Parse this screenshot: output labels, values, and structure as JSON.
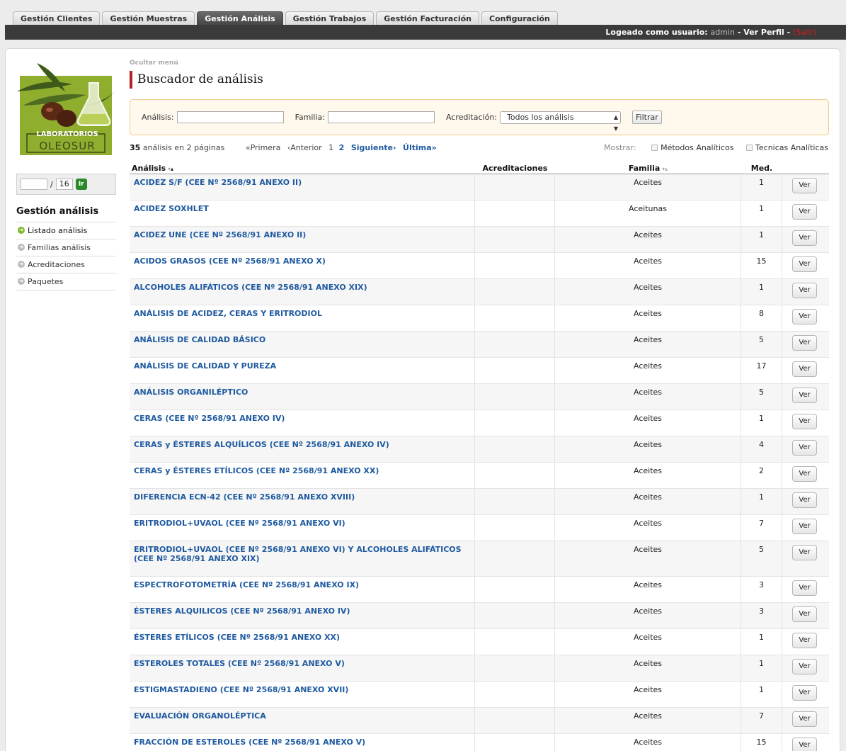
{
  "tabs": [
    {
      "label": "Gestión Clientes",
      "active": false
    },
    {
      "label": "Gestión Muestras",
      "active": false
    },
    {
      "label": "Gestión Análisis",
      "active": true
    },
    {
      "label": "Gestión Trabajos",
      "active": false
    },
    {
      "label": "Gestión Facturación",
      "active": false
    },
    {
      "label": "Configuración",
      "active": false
    }
  ],
  "userbar": {
    "prefix": "Logeado como usuario:",
    "user": "admin",
    "sep1": "-",
    "profile": "Ver Perfil",
    "sep2": "-",
    "logout": "(Salir)"
  },
  "logo": {
    "line1": "LABORATORIOS",
    "line2": "OLEOSUR",
    "colors": {
      "green": "#8fae2e",
      "dark": "#3d4a1c"
    }
  },
  "goto": {
    "value": "",
    "total": "16",
    "button": "Ir"
  },
  "sidebar": {
    "title": "Gestión análisis",
    "items": [
      {
        "label": "Listado análisis",
        "active": true
      },
      {
        "label": "Familias análisis",
        "active": false
      },
      {
        "label": "Acreditaciones",
        "active": false
      },
      {
        "label": "Paquetes",
        "active": false
      }
    ]
  },
  "content": {
    "hide_menu": "Ocultar menú",
    "title": "Buscador de análisis"
  },
  "filter": {
    "analisis_label": "Análisis:",
    "analisis_value": "",
    "familia_label": "Familia:",
    "familia_value": "",
    "acreditacion_label": "Acreditación:",
    "acreditacion_value": "Todos los análisis",
    "button": "Filtrar"
  },
  "pager": {
    "count": "35",
    "count_text": "análisis en 2 páginas",
    "first": "«Primera",
    "prev": "‹Anterior",
    "page1": "1",
    "page2": "2",
    "next": "Siguiente›",
    "last": "Última»"
  },
  "show": {
    "label": "Mostrar:",
    "opt1": "Métodos Analíticos",
    "opt2": "Tecnicas Analíticas"
  },
  "table": {
    "headers": {
      "analisis": "Análisis",
      "acreditaciones": "Acreditaciones",
      "familia": "Familia",
      "med": "Med."
    },
    "ver_label": "Ver",
    "rows": [
      {
        "name": "ACIDEZ S/F (CEE Nº 2568/91 ANEXO II)",
        "acred": "",
        "familia": "Aceites",
        "med": "1"
      },
      {
        "name": "ACIDEZ SOXHLET",
        "acred": "",
        "familia": "Aceitunas",
        "med": "1"
      },
      {
        "name": "ACIDEZ UNE (CEE Nº 2568/91 ANEXO II)",
        "acred": "",
        "familia": "Aceites",
        "med": "1"
      },
      {
        "name": "ACIDOS GRASOS (CEE Nº 2568/91 ANEXO X)",
        "acred": "",
        "familia": "Aceites",
        "med": "15"
      },
      {
        "name": "ALCOHOLES ALIFÁTICOS (CEE Nº 2568/91 ANEXO XIX)",
        "acred": "",
        "familia": "Aceites",
        "med": "1"
      },
      {
        "name": "ANÁLISIS DE ACIDEZ, CERAS Y ERITRODIOL",
        "acred": "",
        "familia": "Aceites",
        "med": "8"
      },
      {
        "name": "ANÁLISIS DE CALIDAD BÁSICO",
        "acred": "",
        "familia": "Aceites",
        "med": "5"
      },
      {
        "name": "ANÁLISIS DE CALIDAD Y PUREZA",
        "acred": "",
        "familia": "Aceites",
        "med": "17"
      },
      {
        "name": "ANÁLISIS ORGANILÉPTICO",
        "acred": "",
        "familia": "Aceites",
        "med": "5"
      },
      {
        "name": "CERAS (CEE Nº 2568/91 ANEXO IV)",
        "acred": "",
        "familia": "Aceites",
        "med": "1"
      },
      {
        "name": "CERAS y ÉSTERES ALQUÍLICOS (CEE Nº 2568/91 ANEXO IV)",
        "acred": "",
        "familia": "Aceites",
        "med": "4"
      },
      {
        "name": "CERAS y ÉSTERES ETÍLICOS (CEE Nº 2568/91 ANEXO XX)",
        "acred": "",
        "familia": "Aceites",
        "med": "2"
      },
      {
        "name": "DIFERENCIA ECN-42 (CEE Nº 2568/91 ANEXO XVIII)",
        "acred": "",
        "familia": "Aceites",
        "med": "1"
      },
      {
        "name": "ERITRODIOL+UVAOL (CEE Nº 2568/91 ANEXO VI)",
        "acred": "",
        "familia": "Aceites",
        "med": "7"
      },
      {
        "name": "ERITRODIOL+UVAOL (CEE Nº 2568/91 ANEXO VI) Y ALCOHOLES ALIFÁTICOS (CEE Nº 2568/91 ANEXO XIX)",
        "acred": "",
        "familia": "Aceites",
        "med": "5",
        "tall": true
      },
      {
        "name": "ESPECTROFOTOMETRÍA (CEE Nº 2568/91 ANEXO IX)",
        "acred": "",
        "familia": "Aceites",
        "med": "3"
      },
      {
        "name": "ÉSTERES ALQUILICOS (CEE Nº 2568/91 ANEXO IV)",
        "acred": "",
        "familia": "Aceites",
        "med": "3"
      },
      {
        "name": "ÉSTERES ETÍLICOS (CEE Nº 2568/91 ANEXO XX)",
        "acred": "",
        "familia": "Aceites",
        "med": "1"
      },
      {
        "name": "ESTEROLES TOTALES (CEE Nº 2568/91 ANEXO V)",
        "acred": "",
        "familia": "Aceites",
        "med": "1"
      },
      {
        "name": "ESTIGMASTADIENO (CEE Nº 2568/91 ANEXO XVII)",
        "acred": "",
        "familia": "Aceites",
        "med": "1"
      },
      {
        "name": "EVALUACIÓN ORGANOLÉPTICA",
        "acred": "",
        "familia": "Aceites",
        "med": "7"
      },
      {
        "name": "FRACCIÓN DE ESTEROLES (CEE Nº 2568/91 ANEXO V)",
        "acred": "",
        "familia": "Aceites",
        "med": "15"
      }
    ]
  }
}
